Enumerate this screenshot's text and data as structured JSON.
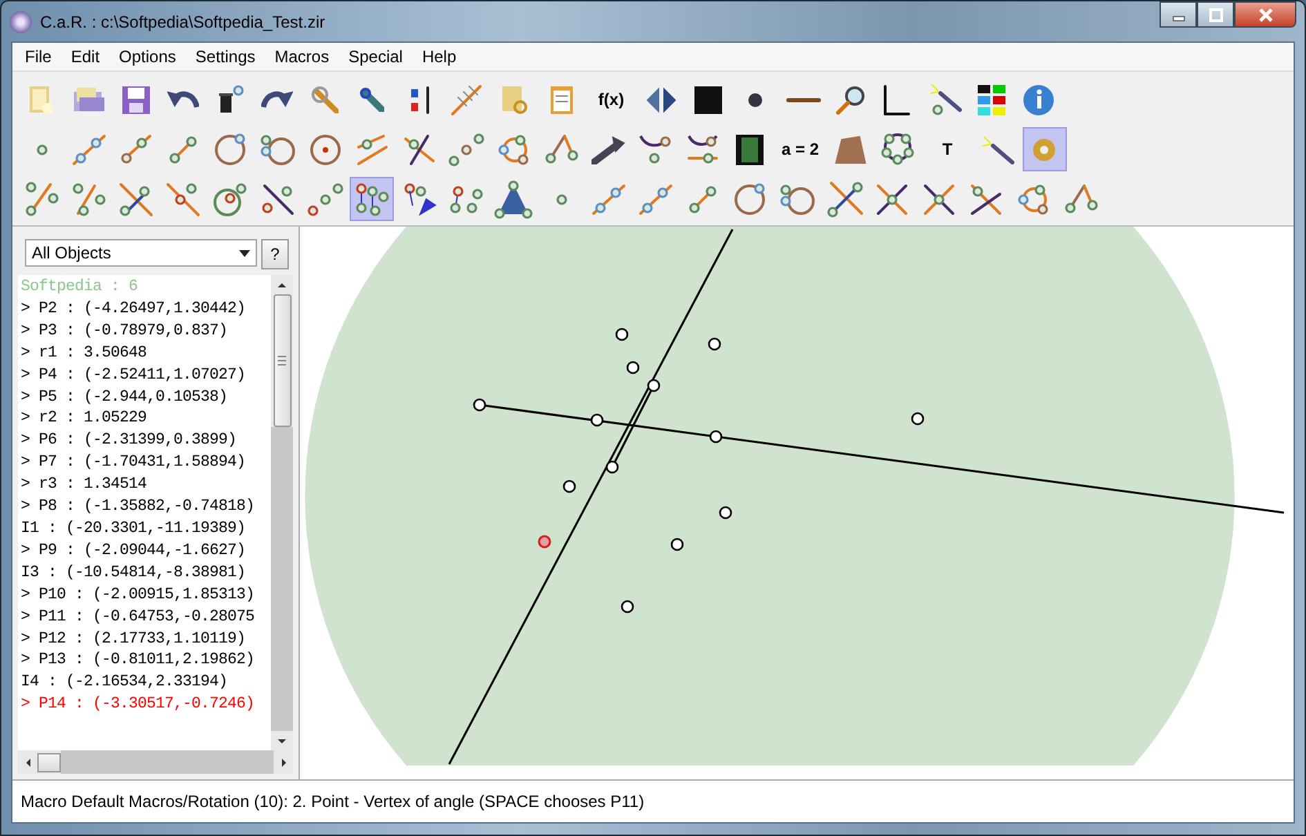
{
  "window": {
    "title": "C.a.R. : c:\\Softpedia\\Softpedia_Test.zir"
  },
  "menu": [
    "File",
    "Edit",
    "Options",
    "Settings",
    "Macros",
    "Special",
    "Help"
  ],
  "toolbars": [
    {
      "buttons": [
        {
          "kind": "icon",
          "selected": false
        },
        {
          "kind": "icon",
          "selected": false
        },
        {
          "kind": "icon",
          "selected": false
        },
        {
          "kind": "icon",
          "selected": false
        },
        {
          "kind": "icon",
          "selected": false
        },
        {
          "kind": "icon",
          "selected": false
        },
        {
          "kind": "icon",
          "selected": false
        },
        {
          "kind": "icon",
          "selected": false
        },
        {
          "kind": "icon",
          "selected": false
        },
        {
          "kind": "icon",
          "selected": false
        },
        {
          "kind": "icon",
          "selected": false
        },
        {
          "kind": "icon",
          "selected": false
        },
        {
          "kind": "text",
          "label": "f(x)",
          "selected": false
        },
        {
          "kind": "icon",
          "selected": false
        },
        {
          "kind": "icon",
          "selected": false
        },
        {
          "kind": "icon",
          "selected": false
        },
        {
          "kind": "icon",
          "selected": false
        },
        {
          "kind": "icon",
          "selected": false
        },
        {
          "kind": "icon",
          "selected": false
        },
        {
          "kind": "icon",
          "selected": false
        },
        {
          "kind": "icon",
          "selected": false
        },
        {
          "kind": "icon",
          "selected": false
        }
      ]
    },
    {
      "buttons": [
        {
          "kind": "icon",
          "selected": false
        },
        {
          "kind": "icon",
          "selected": false
        },
        {
          "kind": "icon",
          "selected": false
        },
        {
          "kind": "icon",
          "selected": false
        },
        {
          "kind": "icon",
          "selected": false
        },
        {
          "kind": "icon",
          "selected": false
        },
        {
          "kind": "icon",
          "selected": false
        },
        {
          "kind": "icon",
          "selected": false
        },
        {
          "kind": "icon",
          "selected": false
        },
        {
          "kind": "icon",
          "selected": false
        },
        {
          "kind": "icon",
          "selected": false
        },
        {
          "kind": "icon",
          "selected": false
        },
        {
          "kind": "icon",
          "selected": false
        },
        {
          "kind": "icon",
          "selected": false
        },
        {
          "kind": "icon",
          "selected": false
        },
        {
          "kind": "icon",
          "selected": false
        },
        {
          "kind": "text",
          "label": "a = 2",
          "selected": false
        },
        {
          "kind": "icon",
          "selected": false
        },
        {
          "kind": "icon",
          "selected": false
        },
        {
          "kind": "text",
          "label": "T",
          "selected": false
        },
        {
          "kind": "icon",
          "selected": false
        },
        {
          "kind": "icon",
          "selected": true
        }
      ]
    },
    {
      "buttons": [
        {
          "kind": "icon",
          "selected": false
        },
        {
          "kind": "icon",
          "selected": false
        },
        {
          "kind": "icon",
          "selected": false
        },
        {
          "kind": "icon",
          "selected": false
        },
        {
          "kind": "icon",
          "selected": false
        },
        {
          "kind": "icon",
          "selected": false
        },
        {
          "kind": "icon",
          "selected": false
        },
        {
          "kind": "icon",
          "selected": true
        },
        {
          "kind": "icon",
          "selected": false
        },
        {
          "kind": "icon",
          "selected": false
        },
        {
          "kind": "icon",
          "selected": false
        },
        {
          "kind": "icon",
          "selected": false
        },
        {
          "kind": "icon",
          "selected": false
        },
        {
          "kind": "icon",
          "selected": false
        },
        {
          "kind": "icon",
          "selected": false
        },
        {
          "kind": "icon",
          "selected": false
        },
        {
          "kind": "icon",
          "selected": false
        },
        {
          "kind": "icon",
          "selected": false
        },
        {
          "kind": "icon",
          "selected": false
        },
        {
          "kind": "icon",
          "selected": false
        },
        {
          "kind": "icon",
          "selected": false
        },
        {
          "kind": "icon",
          "selected": false
        },
        {
          "kind": "icon",
          "selected": false
        }
      ]
    }
  ],
  "object_panel": {
    "filter": "All Objects",
    "help_button": "?",
    "objects": [
      {
        "text": "Softpedia : 6",
        "color": "#88c888"
      },
      {
        "text": "> P2 : (-4.26497,1.30442)",
        "color": "#000000"
      },
      {
        "text": "> P3 : (-0.78979,0.837)",
        "color": "#000000"
      },
      {
        "text": "> r1 : 3.50648",
        "color": "#000000"
      },
      {
        "text": "> P4 : (-2.52411,1.07027)",
        "color": "#000000"
      },
      {
        "text": "> P5 : (-2.944,0.10538)",
        "color": "#000000"
      },
      {
        "text": "> r2 : 1.05229",
        "color": "#000000"
      },
      {
        "text": "> P6 : (-2.31399,0.3899)",
        "color": "#000000"
      },
      {
        "text": "> P7 : (-1.70431,1.58894)",
        "color": "#000000"
      },
      {
        "text": "> r3 : 1.34514",
        "color": "#000000"
      },
      {
        "text": "> P8 : (-1.35882,-0.74818)",
        "color": "#000000"
      },
      {
        "text": "I1 : (-20.3301,-11.19389)",
        "color": "#000000"
      },
      {
        "text": "> P9 : (-2.09044,-1.6627)",
        "color": "#000000"
      },
      {
        "text": "I3 : (-10.54814,-8.38981)",
        "color": "#000000"
      },
      {
        "text": "> P10 : (-2.00915,1.85313)",
        "color": "#000000"
      },
      {
        "text": "> P11 : (-0.64753,-0.28075",
        "color": "#000000"
      },
      {
        "text": "> P12 : (2.17733,1.10119)",
        "color": "#000000"
      },
      {
        "text": "> P13 : (-0.81011,2.19862)",
        "color": "#000000"
      },
      {
        "text": "I4 : (-2.16534,2.33194)",
        "color": "#000000"
      },
      {
        "text": "> P14 : (-3.30517,-0.7246)",
        "color": "#ff0000"
      }
    ]
  },
  "status_bar": "Macro Default Macros/Rotation (10): 2. Point - Vertex of angle  (SPACE chooses P11)"
}
